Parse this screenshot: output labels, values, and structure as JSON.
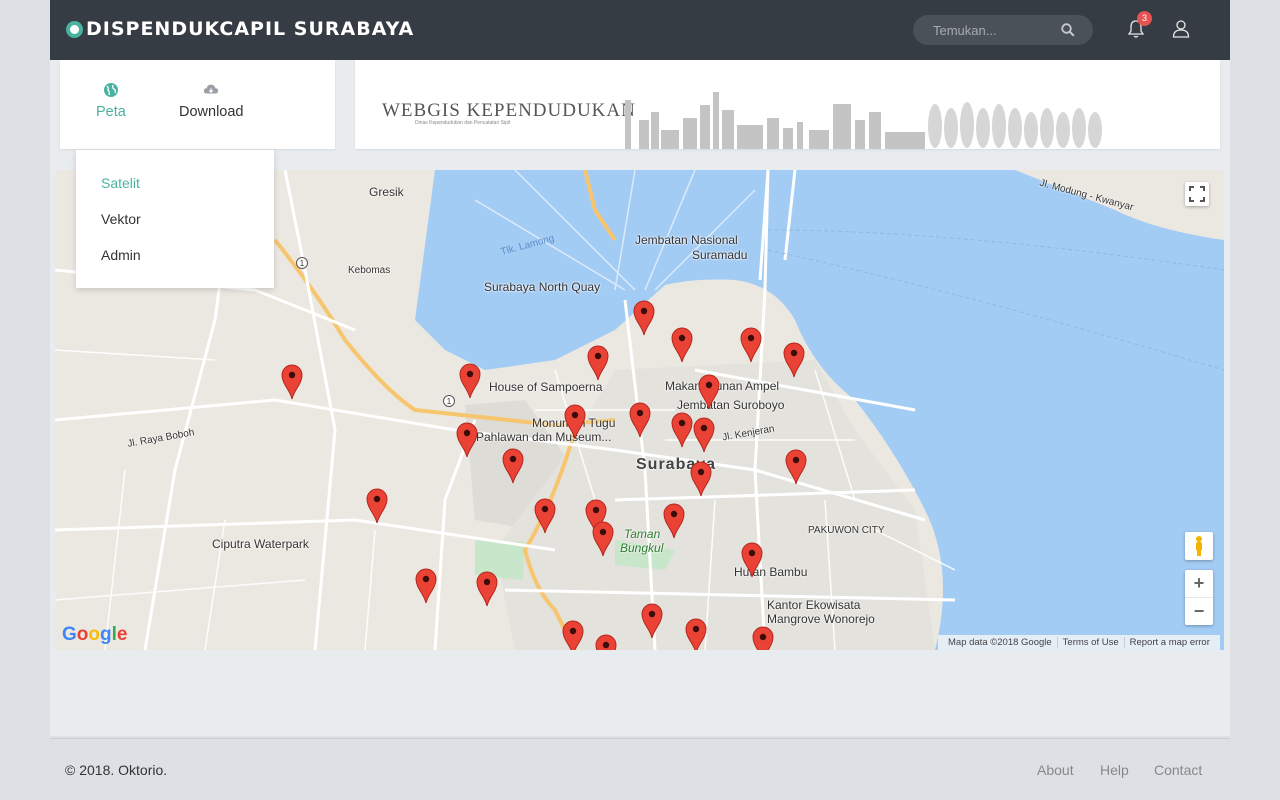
{
  "header": {
    "brand": "DISPENDUKCAPIL SURABAYA",
    "search_placeholder": "Temukan...",
    "notification_count": "3"
  },
  "nav": {
    "tabs": [
      {
        "label": "Peta",
        "icon": "globe-icon",
        "active": true
      },
      {
        "label": "Download",
        "icon": "cloud-download-icon",
        "active": false
      }
    ],
    "dropdown": [
      {
        "label": "Satelit",
        "active": true
      },
      {
        "label": "Vektor",
        "active": false
      },
      {
        "label": "Admin",
        "active": false
      }
    ]
  },
  "banner": {
    "title": "WEBGIS KEPENDUDUKAN",
    "subtitle": "Dinas Kependudukan dan Pencatatan Sipil"
  },
  "map": {
    "labels": {
      "gresik": "Gresik",
      "kebomas": "Kebomas",
      "jembatan": "Jembatan Nasional",
      "suramadu": "Suramadu",
      "northquay": "Surabaya North Quay",
      "lamong": "Tlk. Lamong",
      "sampoerna": "House of Sampoerna",
      "makam": "Makam Sunan Ampel",
      "suroboyo": "Jembatan Suroboyo",
      "monumen": "Monumen Tugu",
      "pahlawan": "Pahlawan dan Museum...",
      "surabaya": "Surabaya",
      "taman": "Taman",
      "bungkul": "Bungkul",
      "ciputra": "Ciputra Waterpark",
      "pakuwon": "PAKUWON CITY",
      "hutan": "Hutan Bambu",
      "kantor": "Kantor Ekowisata",
      "mangrove": "Mangrove Wonorejo",
      "jlkenjeran": "Jl. Kenjeran",
      "jlraya": "Jl. Raya Boboh",
      "jlmodung": "Jl. Modung - Kwanyar",
      "road1": "1"
    },
    "attribution": {
      "data": "Map data ©2018 Google",
      "terms": "Terms of Use",
      "report": "Report a map error"
    },
    "logo": "Google",
    "marker_count": 30
  },
  "footer": {
    "copyright": "© 2018. Oktorio.",
    "links": [
      "About",
      "Help",
      "Contact"
    ]
  },
  "colors": {
    "topbar": "#353c43",
    "accent": "#4ab3a0",
    "sea": "#a3ccf5",
    "marker": "#ea4335"
  }
}
